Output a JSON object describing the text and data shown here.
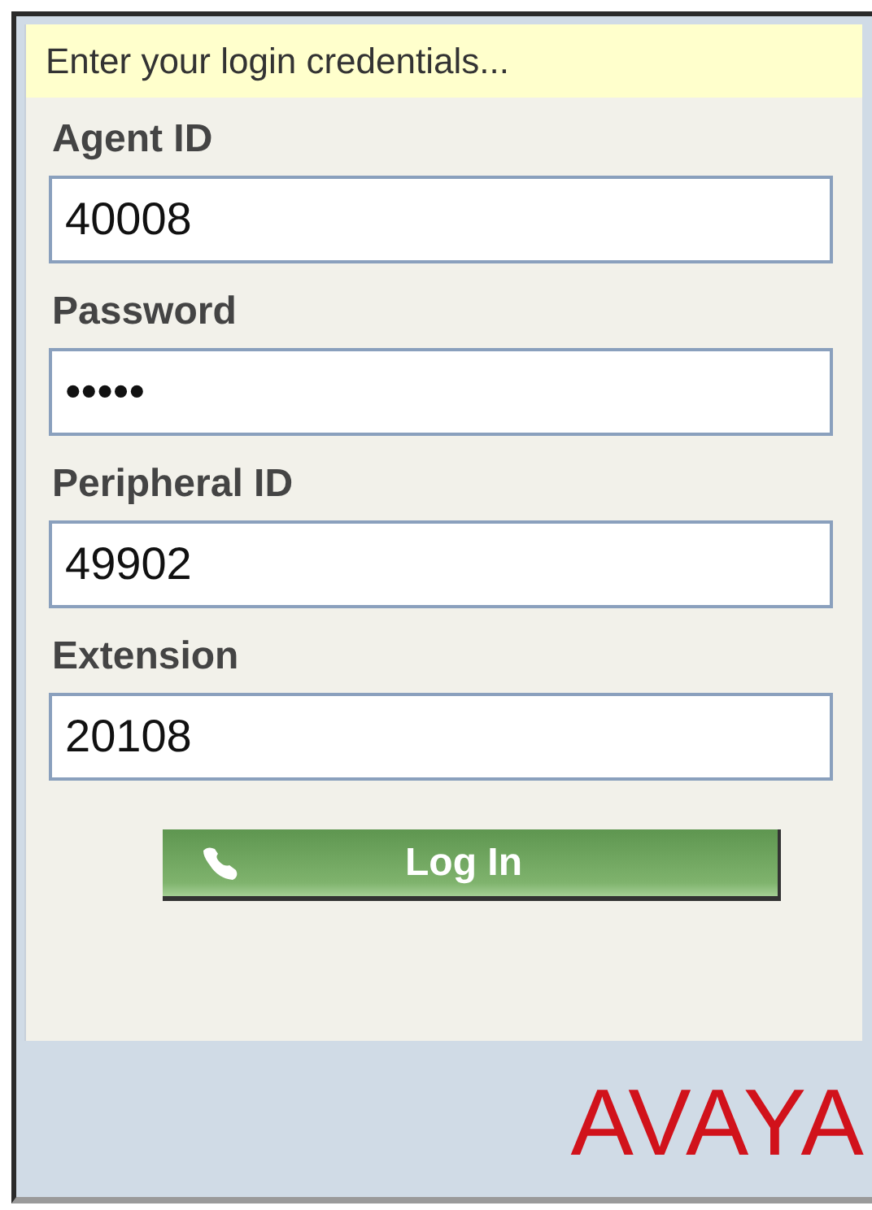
{
  "banner": "Enter your login credentials...",
  "fields": [
    {
      "label": "Agent ID",
      "value": "40008"
    },
    {
      "label": "Password",
      "value": "•••••"
    },
    {
      "label": "Peripheral ID",
      "value": "49902"
    },
    {
      "label": "Extension",
      "value": "20108"
    }
  ],
  "login_button": "Log In",
  "logo": "AVAYA"
}
